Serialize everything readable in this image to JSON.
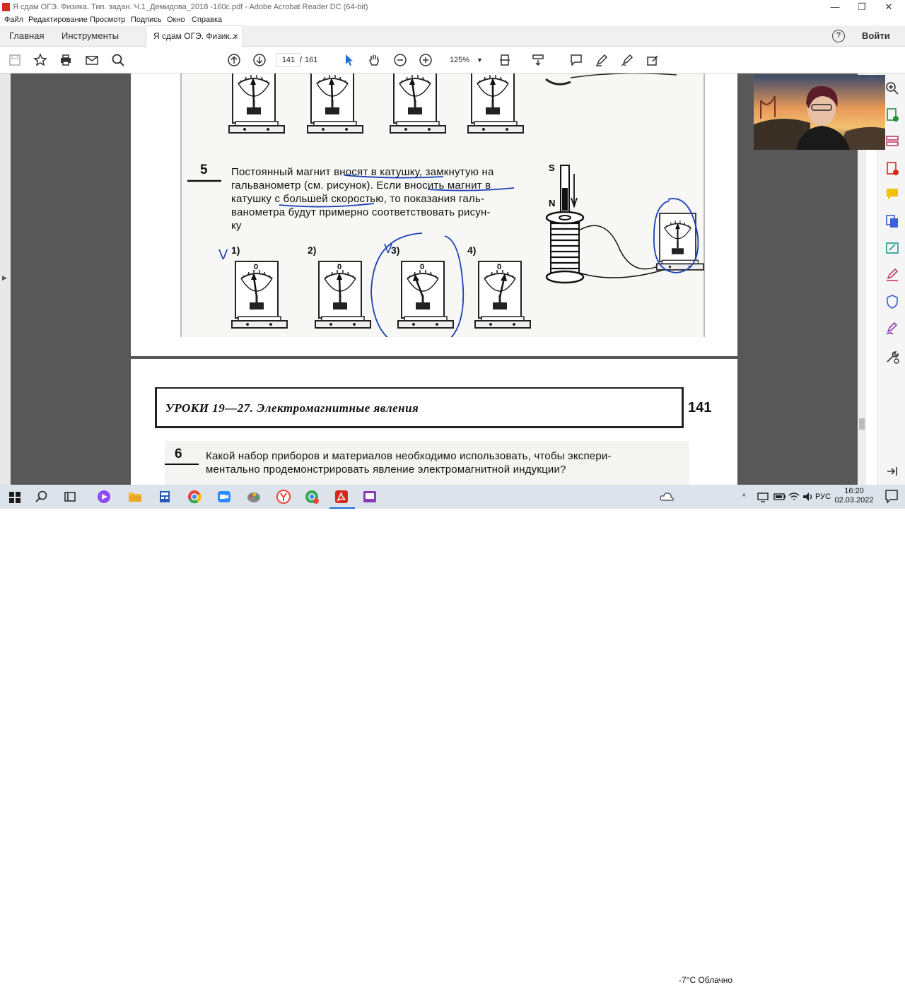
{
  "window": {
    "title": "Я сдам ОГЭ. Физика. Тип. задан. Ч.1_Демидова_2018 -160с.pdf - Adobe Acrobat Reader DC (64-bit)",
    "controls": [
      "—",
      "❐",
      "✕"
    ]
  },
  "menu": [
    "Файл",
    "Редактирование",
    "Просмотр",
    "Подпись",
    "Окно",
    "Справка"
  ],
  "tabs": {
    "home": "Главная",
    "tools": "Инструменты",
    "document": "Я сдам ОГЭ. Физик...",
    "close": "×",
    "help": "?",
    "signin": "Войти"
  },
  "toolbar": {
    "page_current": "141",
    "page_sep": "/",
    "page_total": "161",
    "zoom": "125%"
  },
  "document": {
    "question5": {
      "number": "5",
      "lines": [
        "Постоянный магнит вносят в катушку, замкнутую на",
        "гальванометр (см. рисунок). Если вносить магнит в",
        "катушку с большей скоростью, то показания галь-",
        "ванометра будут примерно соответствовать рисун-",
        "ку"
      ],
      "options": [
        "1)",
        "2)",
        "3)",
        "4)"
      ],
      "gauge_zero": "0",
      "magnet_s": "S",
      "magnet_n": "N",
      "check_mark": "V"
    },
    "header": {
      "title": "УРОКИ 19—27. Электромагнитные явления",
      "page_number": "141"
    },
    "question6": {
      "number": "6",
      "lines": [
        "Какой набор приборов и материалов необходимо использовать, чтобы экспери-",
        "ментально продемонстрировать явление электромагнитной индукции?"
      ]
    }
  },
  "taskbar": {
    "weather": "-7°C Облачно",
    "lang": "РУС",
    "time": "16:20",
    "date": "02.03.2022"
  },
  "colors": {
    "acrobat_red": "#d8271c",
    "ink_blue": "#1b3fb8",
    "taskbar_bg": "#dce3ea",
    "workarea_bg": "#585858"
  }
}
